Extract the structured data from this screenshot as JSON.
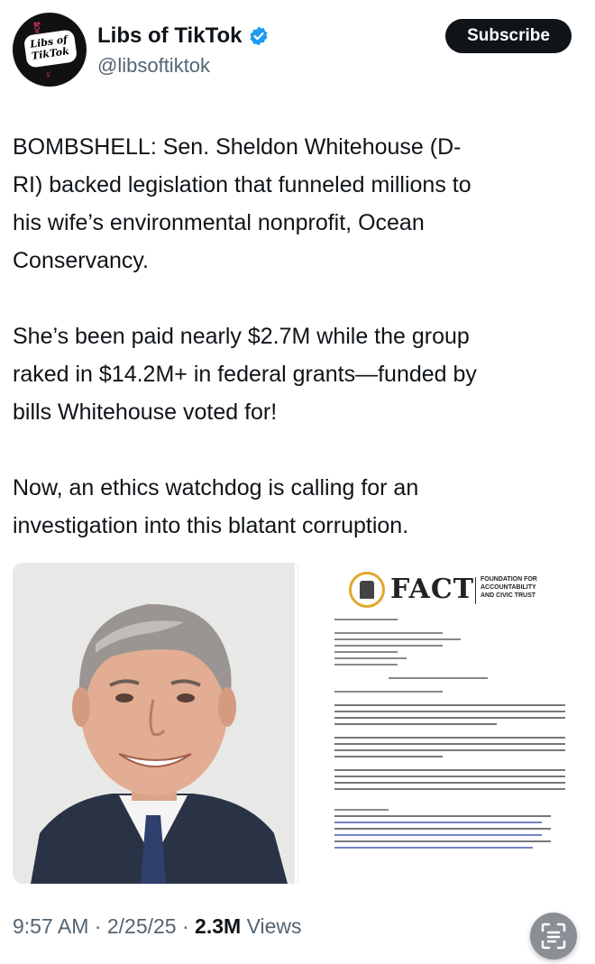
{
  "account": {
    "display_name": "Libs of TikTok",
    "handle": "@libsoftiktok",
    "avatar_text": "Libs of TikTok",
    "verified_icon": "verified-badge-icon"
  },
  "actions": {
    "subscribe_label": "Subscribe"
  },
  "tweet": {
    "paragraphs": [
      "BOMBSHELL: Sen. Sheldon Whitehouse (D-\nRI) backed legislation that funneled millions to\nhis wife’s environmental nonprofit, Ocean\nConservancy.",
      "She’s been paid nearly $2.7M while the group\nraked in $14.2M+ in federal grants—funded by\nbills Whitehouse voted for!",
      "Now, an ethics watchdog is calling for an\ninvestigation into this blatant corruption."
    ]
  },
  "media": {
    "photo_subject": "portrait-photo",
    "document": {
      "logo_text": "FACT",
      "org_name": "FOUNDATION FOR\nACCOUNTABILITY\nAND CIVIC TRUST"
    }
  },
  "meta": {
    "time": "9:57 AM",
    "date": "2/25/25",
    "views_count": "2.3M",
    "views_label": "Views",
    "separator": "·"
  },
  "colors": {
    "text_primary": "#0f1419",
    "text_secondary": "#536471",
    "verified_blue": "#1d9bf0",
    "button_bg": "#0f1419"
  }
}
